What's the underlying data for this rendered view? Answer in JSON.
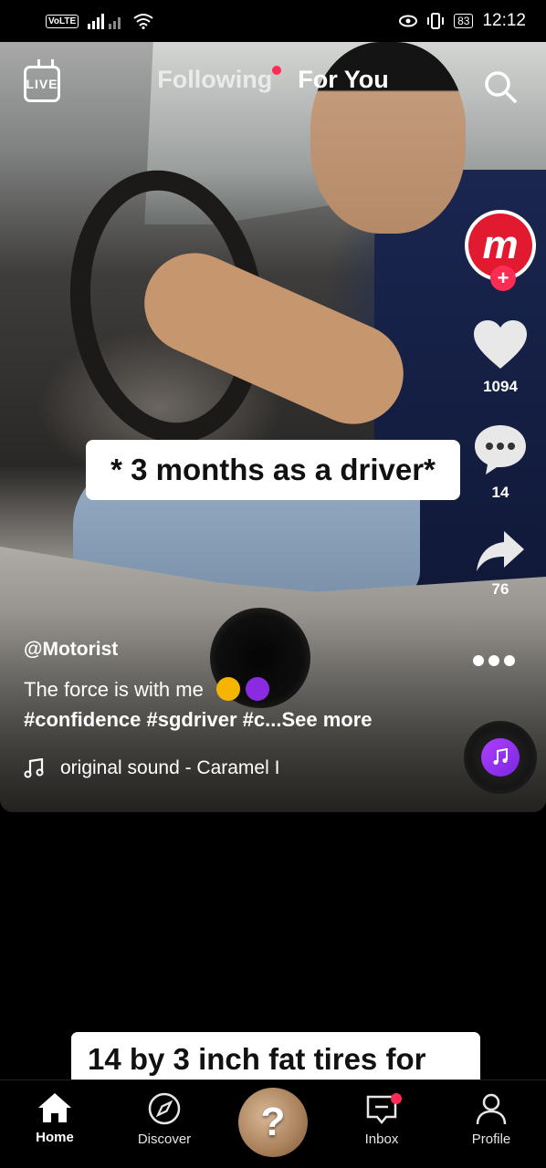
{
  "status_bar": {
    "volte": "VoLTE",
    "battery": "83",
    "time": "12:12"
  },
  "top_nav": {
    "live_label": "LIVE",
    "tabs": [
      {
        "label": "Following",
        "has_notification": true
      },
      {
        "label": "For You",
        "active": true
      }
    ],
    "search_icon": "search-icon"
  },
  "video": {
    "overlay_caption": "* 3 months as a driver*",
    "creator_avatar_letter": "m",
    "follow_icon": "+",
    "likes": "1094",
    "comments": "14",
    "shares": "76",
    "username": "@Motorist",
    "description": "The force is with me",
    "hashtags": "#confidence #sgdriver #c...",
    "see_more": "See more",
    "sound": "original sound - Caramel I"
  },
  "next_video": {
    "caption_peek": "14 by 3 inch fat tires for"
  },
  "bottom_nav": {
    "items": [
      {
        "label": "Home",
        "icon": "home-icon",
        "active": true
      },
      {
        "label": "Discover",
        "icon": "compass-icon"
      },
      {
        "label": "?",
        "icon": "create-avatar"
      },
      {
        "label": "Inbox",
        "icon": "inbox-icon",
        "has_notification": true
      },
      {
        "label": "Profile",
        "icon": "profile-icon"
      }
    ]
  },
  "colors": {
    "accent": "#fe2c55",
    "brand_red": "#e21a2f",
    "background": "#000000"
  }
}
